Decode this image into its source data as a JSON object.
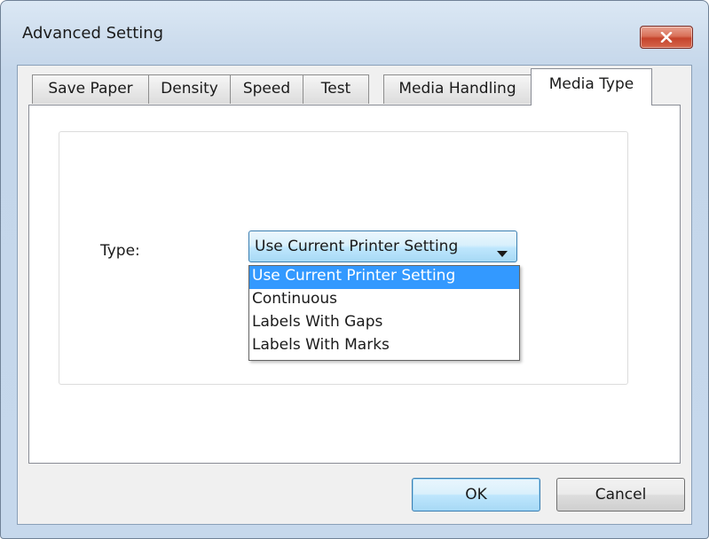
{
  "window": {
    "title": "Advanced Setting",
    "close_icon": "close-icon"
  },
  "tabs": [
    {
      "label": "Save Paper",
      "active": false
    },
    {
      "label": "Density",
      "active": false
    },
    {
      "label": "Speed",
      "active": false
    },
    {
      "label": "Test",
      "active": false
    },
    {
      "label": "Media Handling",
      "active": false
    },
    {
      "label": "Media Type",
      "active": true
    }
  ],
  "media_type": {
    "type_label": "Type:",
    "selected_value": "Use Current Printer Setting",
    "options": [
      {
        "label": "Use Current Printer Setting",
        "highlighted": true
      },
      {
        "label": "Continuous",
        "highlighted": false
      },
      {
        "label": "Labels With Gaps",
        "highlighted": false
      },
      {
        "label": "Labels With Marks",
        "highlighted": false
      }
    ]
  },
  "buttons": {
    "ok": "OK",
    "cancel": "Cancel"
  },
  "colors": {
    "highlight": "#3399ff",
    "close_button": "#c5442c",
    "title_bar": "#cfdeee"
  }
}
